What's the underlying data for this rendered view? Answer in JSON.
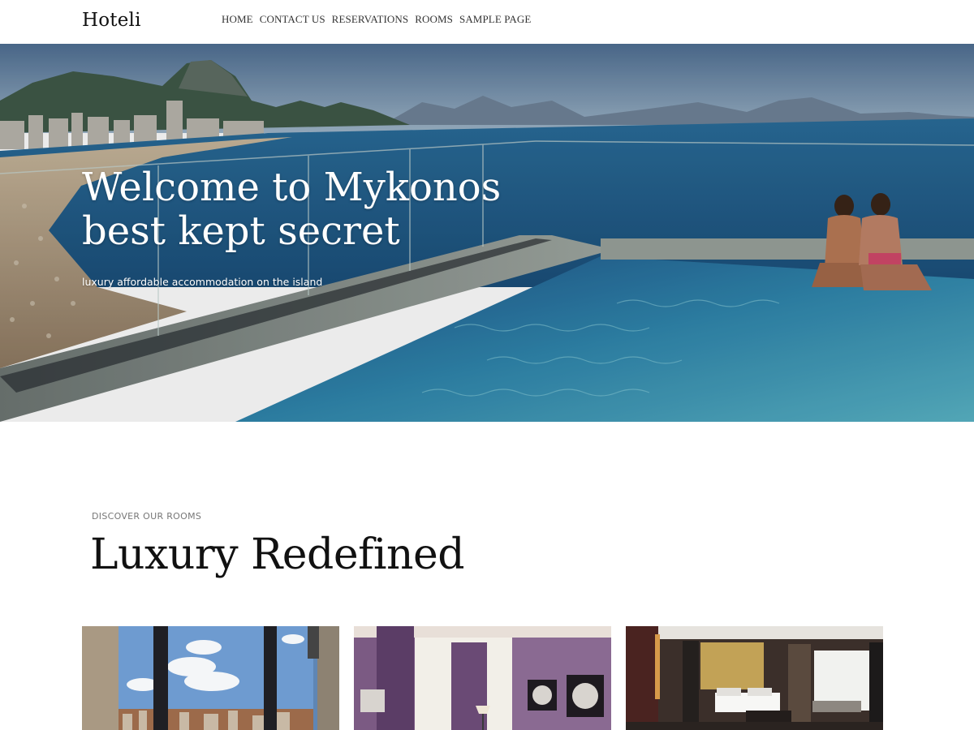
{
  "site": {
    "logo": "Hoteli"
  },
  "nav": {
    "items": [
      "HOME",
      "CONTACT US",
      "RESERVATIONS",
      "ROOMS",
      "SAMPLE PAGE"
    ]
  },
  "hero": {
    "title_line1": "Welcome to Mykonos",
    "title_line2": "best kept secret",
    "subtitle": "luxury affordable accommodation on the island"
  },
  "rooms": {
    "eyebrow": "DISCOVER OUR ROOMS",
    "title": "Luxury Redefined",
    "cards": [
      {
        "image": "window-city-view-photo"
      },
      {
        "image": "purple-bedroom-photo"
      },
      {
        "image": "hotel-suite-photo"
      }
    ]
  },
  "colors": {
    "sea": "#1d5f8f",
    "pool": "#2e8fb0",
    "sky": "#6a8fae",
    "accent_purple": "#6c4a78"
  }
}
